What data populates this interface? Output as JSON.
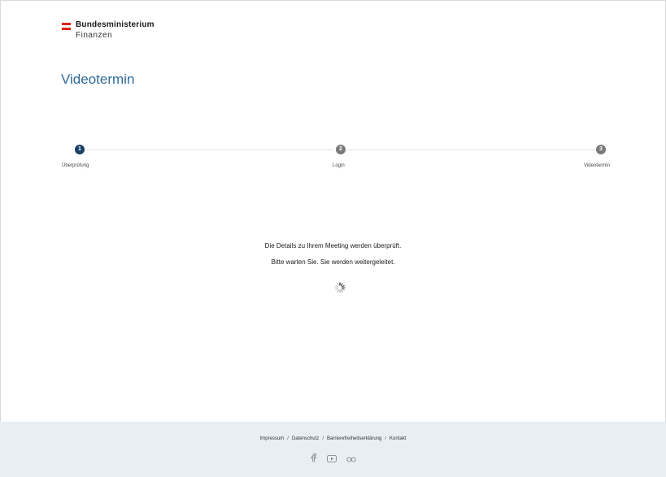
{
  "brand": {
    "line1": "Bundesministerium",
    "line2": "Finanzen",
    "flag_colors": [
      "#e2231a",
      "#ffffff",
      "#e2231a"
    ]
  },
  "page": {
    "title": "Videotermin"
  },
  "stepper": {
    "steps": [
      {
        "number": "1",
        "label": "Überprüfung",
        "active": true
      },
      {
        "number": "2",
        "label": "Login",
        "active": false
      },
      {
        "number": "3",
        "label": "Videotermin",
        "active": false
      }
    ],
    "active_color": "#173f65",
    "inactive_color": "#7a7a7a"
  },
  "status": {
    "line1": "Die Details zu Ihrem Meeting werden überprüft.",
    "line2": "Bitte warten Sie. Sie werden weitergeleitet.",
    "spinner_icon": "loading-spinner-icon"
  },
  "footer": {
    "links": [
      "Impressum",
      "Datenschutz",
      "Barrierefreiheitserklärung",
      "Kontakt"
    ],
    "separator": "/",
    "social_icons": [
      "facebook-icon",
      "youtube-icon",
      "flickr-icon"
    ],
    "background": "#e9eef3"
  },
  "colors": {
    "title": "#2f6a9a"
  }
}
